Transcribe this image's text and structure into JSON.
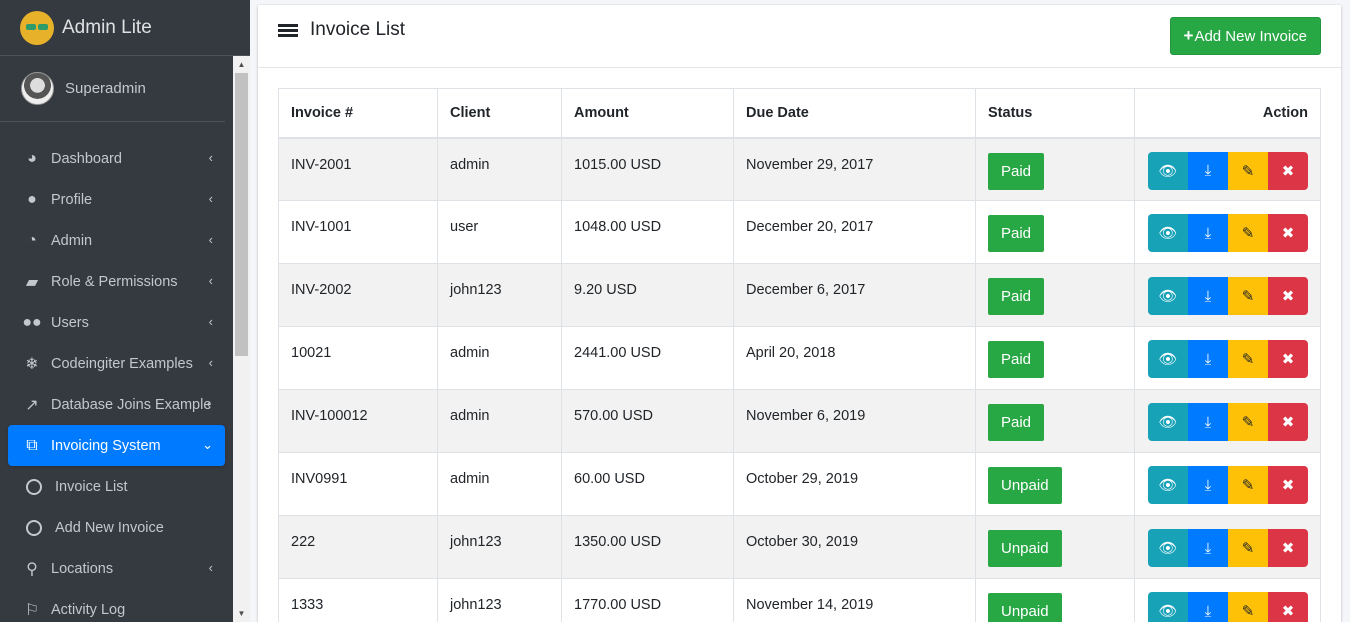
{
  "brand": {
    "name": "Admin Lite"
  },
  "user": {
    "name": "Superadmin"
  },
  "sidebar": {
    "items": [
      {
        "label": "Dashboard",
        "icon": "dashboard-icon"
      },
      {
        "label": "Profile",
        "icon": "user-icon"
      },
      {
        "label": "Admin",
        "icon": "pie-chart-icon"
      },
      {
        "label": "Role & Permissions",
        "icon": "book-icon"
      },
      {
        "label": "Users",
        "icon": "users-icon"
      },
      {
        "label": "Codeingiter Examples",
        "icon": "snowflake-icon"
      },
      {
        "label": "Database Joins Example",
        "icon": "external-link-icon"
      },
      {
        "label": "Invoicing System",
        "icon": "copy-icon",
        "active": true
      },
      {
        "label": "Invoice List",
        "icon": "circle-icon"
      },
      {
        "label": "Add New Invoice",
        "icon": "circle-icon"
      },
      {
        "label": "Locations",
        "icon": "map-marker-icon"
      },
      {
        "label": "Activity Log",
        "icon": "flag-icon"
      }
    ]
  },
  "main": {
    "title": "Invoice List",
    "add_button": "Add New Invoice",
    "table": {
      "headers": [
        "Invoice #",
        "Client",
        "Amount",
        "Due Date",
        "Status",
        "Action"
      ],
      "rows": [
        {
          "invoice": "INV-2001",
          "client": "admin",
          "amount": "1015.00 USD",
          "due": "November 29, 2017",
          "status": "Paid"
        },
        {
          "invoice": "INV-1001",
          "client": "user",
          "amount": "1048.00 USD",
          "due": "December 20, 2017",
          "status": "Paid"
        },
        {
          "invoice": "INV-2002",
          "client": "john123",
          "amount": "9.20 USD",
          "due": "December 6, 2017",
          "status": "Paid"
        },
        {
          "invoice": "10021",
          "client": "admin",
          "amount": "2441.00 USD",
          "due": "April 20, 2018",
          "status": "Paid"
        },
        {
          "invoice": "INV-100012",
          "client": "admin",
          "amount": "570.00 USD",
          "due": "November 6, 2019",
          "status": "Paid"
        },
        {
          "invoice": "INV0991",
          "client": "admin",
          "amount": "60.00 USD",
          "due": "October 29, 2019",
          "status": "Unpaid"
        },
        {
          "invoice": "222",
          "client": "john123",
          "amount": "1350.00 USD",
          "due": "October 30, 2019",
          "status": "Unpaid"
        },
        {
          "invoice": "1333",
          "client": "john123",
          "amount": "1770.00 USD",
          "due": "November 14, 2019",
          "status": "Unpaid"
        }
      ]
    }
  },
  "colors": {
    "sidebar_bg": "#343a40",
    "active": "#007bff",
    "success": "#28a745",
    "info": "#17a2b8",
    "warning": "#ffc107",
    "danger": "#dc3545"
  }
}
